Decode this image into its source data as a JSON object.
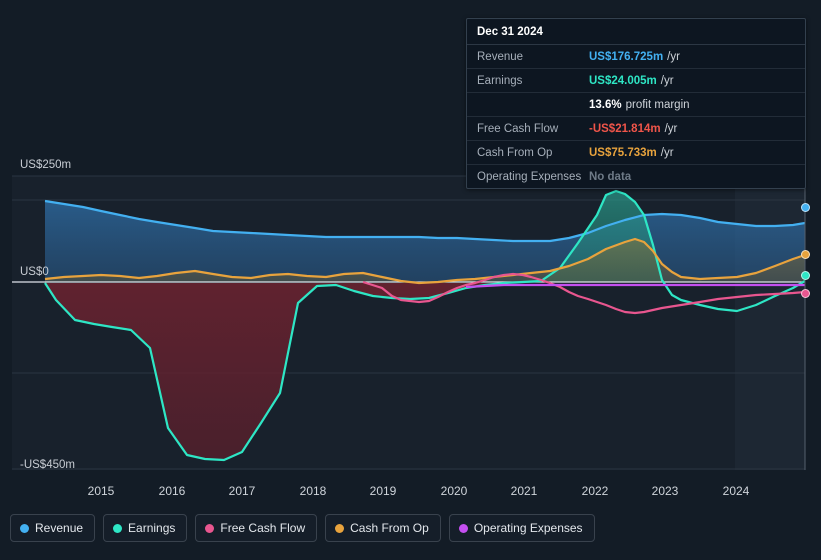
{
  "chart_data": {
    "type": "area",
    "title": "",
    "xlabel": "",
    "ylabel": "",
    "ylim": [
      -450,
      250
    ],
    "y_unit": "US$m",
    "grid": true,
    "legend_position": "bottom-left",
    "axis": {
      "y_ticks": [
        {
          "value": 250,
          "label": "US$250m"
        },
        {
          "value": 0,
          "label": "US$0"
        },
        {
          "value": -450,
          "label": "-US$450m"
        }
      ],
      "x_ticks": [
        "2015",
        "2016",
        "2017",
        "2018",
        "2019",
        "2020",
        "2021",
        "2022",
        "2023",
        "2024"
      ],
      "x_range": [
        "2014.3",
        "2025.0"
      ]
    },
    "series": [
      {
        "name": "Revenue",
        "color": "#43b0f1",
        "x": [
          2014.35,
          2014.6,
          2014.85,
          2015.1,
          2015.35,
          2015.6,
          2015.85,
          2016.1,
          2016.35,
          2016.6,
          2016.85,
          2017.1,
          2017.35,
          2017.6,
          2017.85,
          2018.1,
          2018.35,
          2018.6,
          2018.85,
          2019.1,
          2019.35,
          2019.6,
          2019.85,
          2020.1,
          2020.35,
          2020.6,
          2020.85,
          2021.1,
          2021.35,
          2021.6,
          2021.85,
          2022.1,
          2022.35,
          2022.6,
          2022.85,
          2023.1,
          2023.35,
          2023.6,
          2023.85,
          2024.1,
          2024.35,
          2024.6,
          2024.85,
          2025.0
        ],
        "values": [
          224,
          218,
          211,
          203,
          194,
          186,
          179,
          172,
          166,
          160,
          157,
          155,
          153,
          151,
          149,
          147,
          146,
          146,
          147,
          147,
          146,
          145,
          144,
          143,
          141,
          139,
          138,
          139,
          144,
          155,
          169,
          182,
          192,
          196,
          193,
          186,
          178,
          172,
          168,
          167,
          168,
          171,
          175,
          176.725
        ]
      },
      {
        "name": "Earnings",
        "color": "#2ee6c5",
        "x": [
          2014.35,
          2014.6,
          2014.85,
          2015.1,
          2015.35,
          2015.6,
          2015.85,
          2016.1,
          2016.35,
          2016.6,
          2016.85,
          2017.1,
          2017.35,
          2017.6,
          2017.85,
          2018.1,
          2018.35,
          2018.6,
          2018.85,
          2019.1,
          2019.35,
          2019.6,
          2019.85,
          2020.1,
          2020.35,
          2020.6,
          2020.85,
          2021.1,
          2021.35,
          2021.6,
          2021.85,
          2022.1,
          2022.35,
          2022.6,
          2022.85,
          2023.1,
          2023.35,
          2023.6,
          2023.85,
          2024.1,
          2024.35,
          2024.6,
          2024.85,
          2025.0
        ],
        "values": [
          3,
          -25,
          -80,
          -130,
          -145,
          -150,
          -160,
          -200,
          -380,
          -430,
          -438,
          -440,
          -420,
          -330,
          -120,
          -10,
          -8,
          -20,
          -35,
          -42,
          -45,
          -42,
          -30,
          -15,
          -8,
          -4,
          -2,
          8,
          40,
          95,
          150,
          185,
          200,
          185,
          150,
          40,
          -15,
          -25,
          -28,
          -32,
          -20,
          5,
          20,
          24.005
        ]
      },
      {
        "name": "Free Cash Flow",
        "color": "#e8568f",
        "x": [
          2018.1,
          2018.35,
          2018.6,
          2018.85,
          2019.1,
          2019.35,
          2019.6,
          2019.85,
          2020.1,
          2020.35,
          2020.6,
          2020.85,
          2021.1,
          2021.35,
          2021.6,
          2021.85,
          2022.1,
          2022.35,
          2022.6,
          2022.85,
          2023.1,
          2023.35,
          2023.6,
          2023.85,
          2024.1,
          2024.35,
          2024.6,
          2024.85,
          2025.0
        ],
        "values": [
          0,
          -5,
          -25,
          -38,
          -42,
          -45,
          -42,
          -32,
          -18,
          -8,
          -4,
          2,
          12,
          22,
          30,
          26,
          18,
          8,
          -5,
          -18,
          -32,
          -38,
          -42,
          -40,
          -35,
          -30,
          -28,
          -24,
          -21.814
        ]
      },
      {
        "name": "Cash From Op",
        "color": "#e8a33d",
        "x": [
          2014.35,
          2014.6,
          2014.85,
          2015.1,
          2015.35,
          2015.6,
          2015.85,
          2016.1,
          2016.35,
          2016.6,
          2016.85,
          2017.1,
          2017.35,
          2017.6,
          2017.85,
          2018.1,
          2018.35,
          2018.6,
          2018.85,
          2019.1,
          2019.35,
          2019.6,
          2019.85,
          2020.1,
          2020.35,
          2020.6,
          2020.85,
          2021.1,
          2021.35,
          2021.6,
          2021.85,
          2022.1,
          2022.35,
          2022.6,
          2022.85,
          2023.1,
          2023.35,
          2023.6,
          2023.85,
          2024.1,
          2024.35,
          2024.6,
          2024.85,
          2025.0
        ],
        "values": [
          6,
          10,
          14,
          16,
          14,
          10,
          15,
          22,
          26,
          20,
          12,
          10,
          16,
          18,
          14,
          12,
          18,
          20,
          12,
          2,
          -2,
          0,
          4,
          8,
          12,
          16,
          20,
          26,
          36,
          52,
          72,
          90,
          98,
          92,
          74,
          48,
          26,
          12,
          8,
          10,
          20,
          38,
          58,
          75.733
        ]
      },
      {
        "name": "Operating Expenses",
        "color": "#c44ff0",
        "x": [
          2019.85,
          2020.1,
          2020.35,
          2020.6,
          2020.85,
          2021.1,
          2021.35,
          2021.6,
          2021.85,
          2022.1,
          2022.35,
          2022.6,
          2022.85,
          2023.1,
          2023.35,
          2023.6,
          2023.85,
          2024.1,
          2024.35,
          2024.6,
          2024.85,
          2025.0
        ],
        "values": [
          -4,
          -4,
          -4,
          -4,
          -4,
          -4,
          -4,
          -4,
          -4,
          -4,
          -4,
          -4,
          -4,
          -4,
          -4,
          -4,
          -4,
          -4,
          -4,
          -4,
          -4,
          -4
        ]
      }
    ]
  },
  "tooltip": {
    "date": "Dec 31 2024",
    "rows": [
      {
        "label": "Revenue",
        "value": "US$176.725m",
        "suffix": "/yr",
        "color": "#43b0f1"
      },
      {
        "label": "Earnings",
        "value": "US$24.005m",
        "suffix": "/yr",
        "color": "#2ee6c5"
      },
      {
        "label": "",
        "value": "13.6%",
        "suffix": "profit margin",
        "color": "#ffffff"
      },
      {
        "label": "Free Cash Flow",
        "value": "-US$21.814m",
        "suffix": "/yr",
        "color": "#f0554a"
      },
      {
        "label": "Cash From Op",
        "value": "US$75.733m",
        "suffix": "/yr",
        "color": "#e8a33d"
      },
      {
        "label": "Operating Expenses",
        "value": "No data",
        "suffix": "",
        "color": "#6e7a87"
      }
    ]
  },
  "legend": {
    "items": [
      {
        "label": "Revenue",
        "color": "#43b0f1"
      },
      {
        "label": "Earnings",
        "color": "#2ee6c5"
      },
      {
        "label": "Free Cash Flow",
        "color": "#e8568f"
      },
      {
        "label": "Cash From Op",
        "color": "#e8a33d"
      },
      {
        "label": "Operating Expenses",
        "color": "#c44ff0"
      }
    ]
  },
  "axis_labels": {
    "y_top": "US$250m",
    "y_zero": "US$0",
    "y_bottom": "-US$450m",
    "x": [
      "2015",
      "2016",
      "2017",
      "2018",
      "2019",
      "2020",
      "2021",
      "2022",
      "2023",
      "2024"
    ]
  }
}
